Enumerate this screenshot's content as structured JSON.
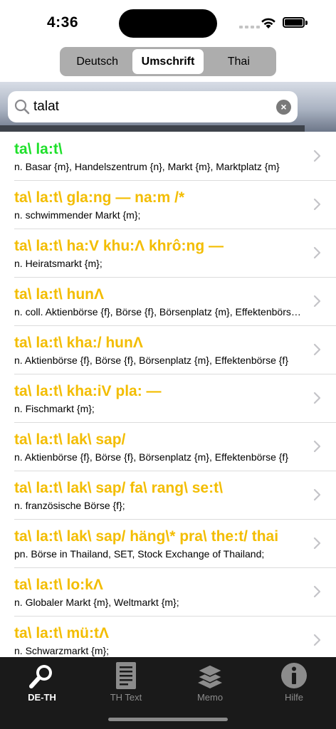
{
  "status": {
    "time": "4:36"
  },
  "segments": {
    "deutsch": "Deutsch",
    "umschrift": "Umschrift",
    "thai": "Thai",
    "selected": "Umschrift"
  },
  "search": {
    "value": "talat"
  },
  "results": [
    {
      "title": "ta\\ la:t\\",
      "sub": "n. Basar {m}, Handelszentrum {n}, Markt {m}, Marktplatz {m}"
    },
    {
      "title": "ta\\ la:t\\ gla:ng — na:m /*",
      "sub": "n. schwimmender Markt {m};"
    },
    {
      "title": "ta\\ la:t\\ ha:V khu:Λ khrô:ng —",
      "sub": "n. Heiratsmarkt {m};"
    },
    {
      "title": "ta\\ la:t\\ hunΛ",
      "sub": "n. coll. Aktienbörse {f}, Börse {f}, Börsenplatz {m}, Effektenbörse {f}"
    },
    {
      "title": "ta\\ la:t\\ kha:/ hunΛ",
      "sub": "n. Aktienbörse {f}, Börse {f}, Börsenplatz {m}, Effektenbörse {f}"
    },
    {
      "title": "ta\\ la:t\\ kha:iV pla: —",
      "sub": "n. Fischmarkt {m};"
    },
    {
      "title": "ta\\ la:t\\ lak\\ sap/",
      "sub": "n. Aktienbörse {f}, Börse {f}, Börsenplatz {m}, Effektenbörse {f}"
    },
    {
      "title": "ta\\ la:t\\ lak\\ sap/ fa\\ rang\\ se:t\\",
      "sub": "n. französische Börse {f};"
    },
    {
      "title": "ta\\ la:t\\ lak\\ sap/ häng\\* pra\\ the:t/ thai",
      "sub": "pn. Börse in Thailand, SET, Stock Exchange of Thailand;"
    },
    {
      "title": "ta\\ la:t\\ lo:kΛ",
      "sub": "n. Globaler Markt {m}, Weltmarkt {m};"
    },
    {
      "title": "ta\\ la:t\\ mü:tΛ",
      "sub": "n. Schwarzmarkt {m};"
    }
  ],
  "tabs": [
    {
      "label": "DE-TH",
      "icon": "search-icon",
      "active": true
    },
    {
      "label": "TH Text",
      "icon": "document-icon",
      "active": false
    },
    {
      "label": "Memo",
      "icon": "layers-icon",
      "active": false
    },
    {
      "label": "Hilfe",
      "icon": "info-icon",
      "active": false
    }
  ],
  "colors": {
    "primary_title": "#1fe02b",
    "result_title": "#f3bd00",
    "tabbar_bg": "#1a1a1a"
  }
}
